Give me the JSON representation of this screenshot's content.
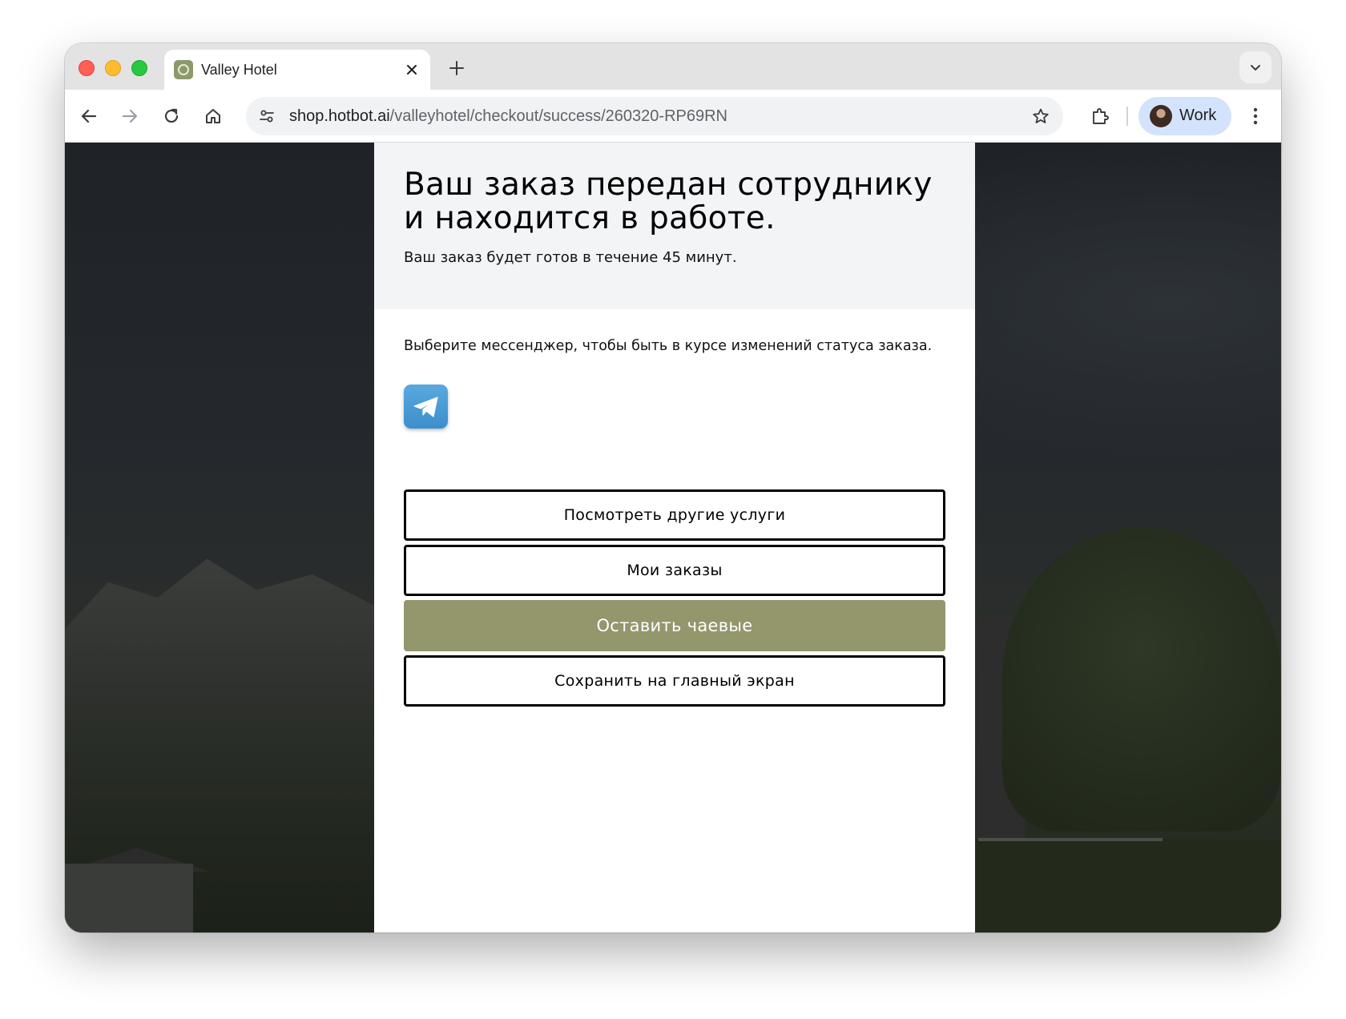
{
  "browser": {
    "tab": {
      "title": "Valley Hotel"
    },
    "url": {
      "host": "shop.hotbot.ai",
      "path": "/valleyhotel/checkout/success/260320-RP69RN"
    },
    "profile": {
      "label": "Work"
    }
  },
  "page": {
    "headline": "Ваш заказ передан сотруднику и находится в работе.",
    "subtitle": "Ваш заказ будет готов в течение 45 минут.",
    "messenger_prompt": "Выберите мессенджер, чтобы быть в курсе изменений статуса заказа.",
    "messenger_icon": "telegram-icon",
    "buttons": {
      "other_services": "Посмотреть другие услуги",
      "my_orders": "Мои заказы",
      "leave_tip": "Оставить чаевые",
      "save_home": "Сохранить на главный экран"
    },
    "colors": {
      "accent_button": "#94966c",
      "telegram": "#3b8fcc",
      "header_background": "#f3f4f6"
    }
  }
}
